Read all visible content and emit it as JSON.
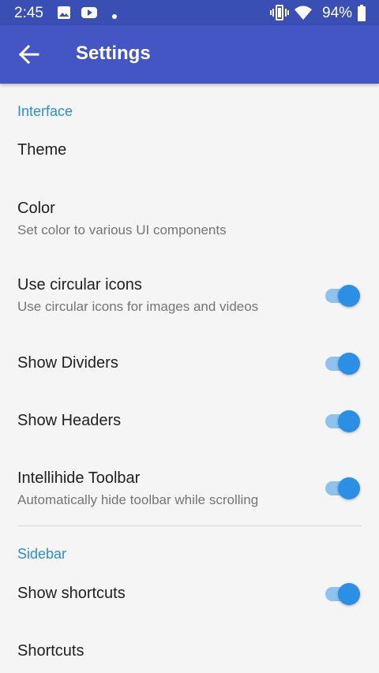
{
  "status_bar": {
    "time": "2:45",
    "battery": "94%",
    "icons": [
      "image-icon",
      "youtube-icon",
      "dot-icon",
      "vibrate-icon",
      "wifi-icon",
      "battery-icon"
    ]
  },
  "app_bar": {
    "title": "Settings",
    "back_icon": "arrow-back-icon"
  },
  "sections": {
    "interface": {
      "header": "Interface",
      "theme": {
        "title": "Theme"
      },
      "color": {
        "title": "Color",
        "summary": "Set color to various UI components"
      },
      "circular_icons": {
        "title": "Use circular icons",
        "summary": "Use circular icons for images and videos",
        "enabled": true
      },
      "show_dividers": {
        "title": "Show Dividers",
        "enabled": true
      },
      "show_headers": {
        "title": "Show Headers",
        "enabled": true
      },
      "intellihide": {
        "title": "Intellihide Toolbar",
        "summary": "Automatically hide toolbar while scrolling",
        "enabled": true
      }
    },
    "sidebar": {
      "header": "Sidebar",
      "show_shortcuts": {
        "title": "Show shortcuts",
        "enabled": true
      },
      "shortcuts": {
        "title": "Shortcuts"
      }
    }
  },
  "colors": {
    "status_bar": "#3a4fb4",
    "app_bar": "#4356c4",
    "accent": "#2b8fd6",
    "switch_thumb": "#2b8fe6",
    "switch_track": "#8fc3ee"
  }
}
